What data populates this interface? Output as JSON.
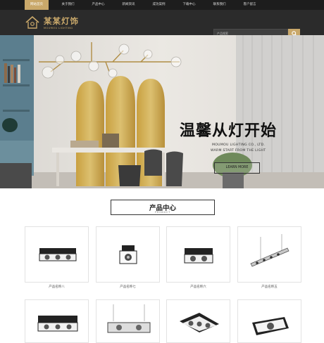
{
  "nav": {
    "items": [
      "网站首页",
      "关于我们",
      "产品中心",
      "新闻资讯",
      "成功案例",
      "下载中心",
      "联系我们",
      "客户留言"
    ],
    "active_index": 0
  },
  "logo": {
    "cn": "某某灯饰",
    "en": "MOUMOU LIGHTING"
  },
  "search": {
    "placeholder": "产品搜索"
  },
  "hero": {
    "title": "温馨从灯开始",
    "subtitle_1": "MOUMOU LIGHTING CO., LTD.",
    "subtitle_2": "WARM START FROM THE LIGHT",
    "button": "LEARN MORE"
  },
  "section": {
    "title": "产品中心",
    "subtitle": "PRODUCT"
  },
  "products": [
    {
      "name": "产品名称八"
    },
    {
      "name": "产品名称七"
    },
    {
      "name": "产品名称六"
    },
    {
      "name": "产品名称五"
    },
    {
      "name": ""
    },
    {
      "name": ""
    },
    {
      "name": ""
    },
    {
      "name": ""
    }
  ],
  "colors": {
    "accent": "#c9a86a",
    "nav_bg": "#1d1d1d",
    "header_bg": "#2b2b2b"
  }
}
